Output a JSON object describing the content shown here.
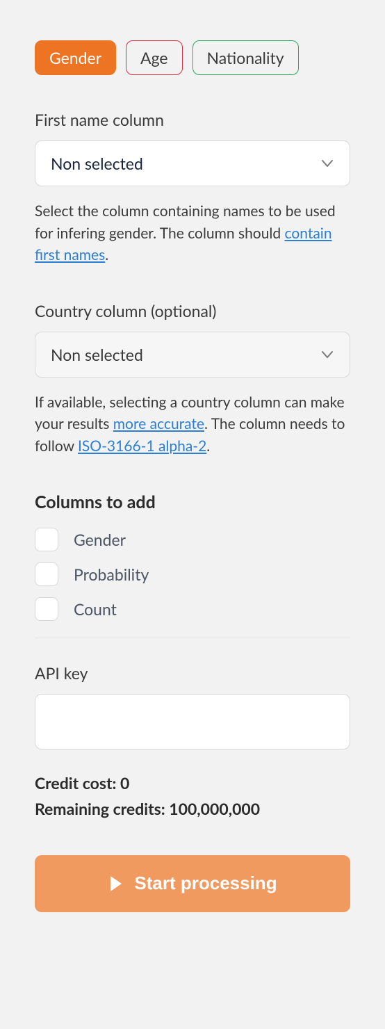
{
  "tabs": {
    "gender": "Gender",
    "age": "Age",
    "nationality": "Nationality"
  },
  "firstName": {
    "label": "First name column",
    "value": "Non selected",
    "help_pre": "Select the column containing names to be used for infering gender. The column should ",
    "help_link": "contain first names",
    "help_post": "."
  },
  "country": {
    "label": "Country column (optional)",
    "value": "Non selected",
    "help_pre": "If available, selecting a country column can make your results ",
    "help_link1": "more accurate",
    "help_mid": ". The column needs to follow ",
    "help_link2": "ISO-3166-1 alpha-2",
    "help_post": "."
  },
  "columnsToAdd": {
    "heading": "Columns to add",
    "items": [
      "Gender",
      "Probability",
      "Count"
    ]
  },
  "apiKey": {
    "label": "API key",
    "value": ""
  },
  "credits": {
    "costLabel": "Credit cost: ",
    "costValue": "0",
    "remainingLabel": "Remaining credits: ",
    "remainingValue": "100,000,000"
  },
  "cta": "Start processing"
}
